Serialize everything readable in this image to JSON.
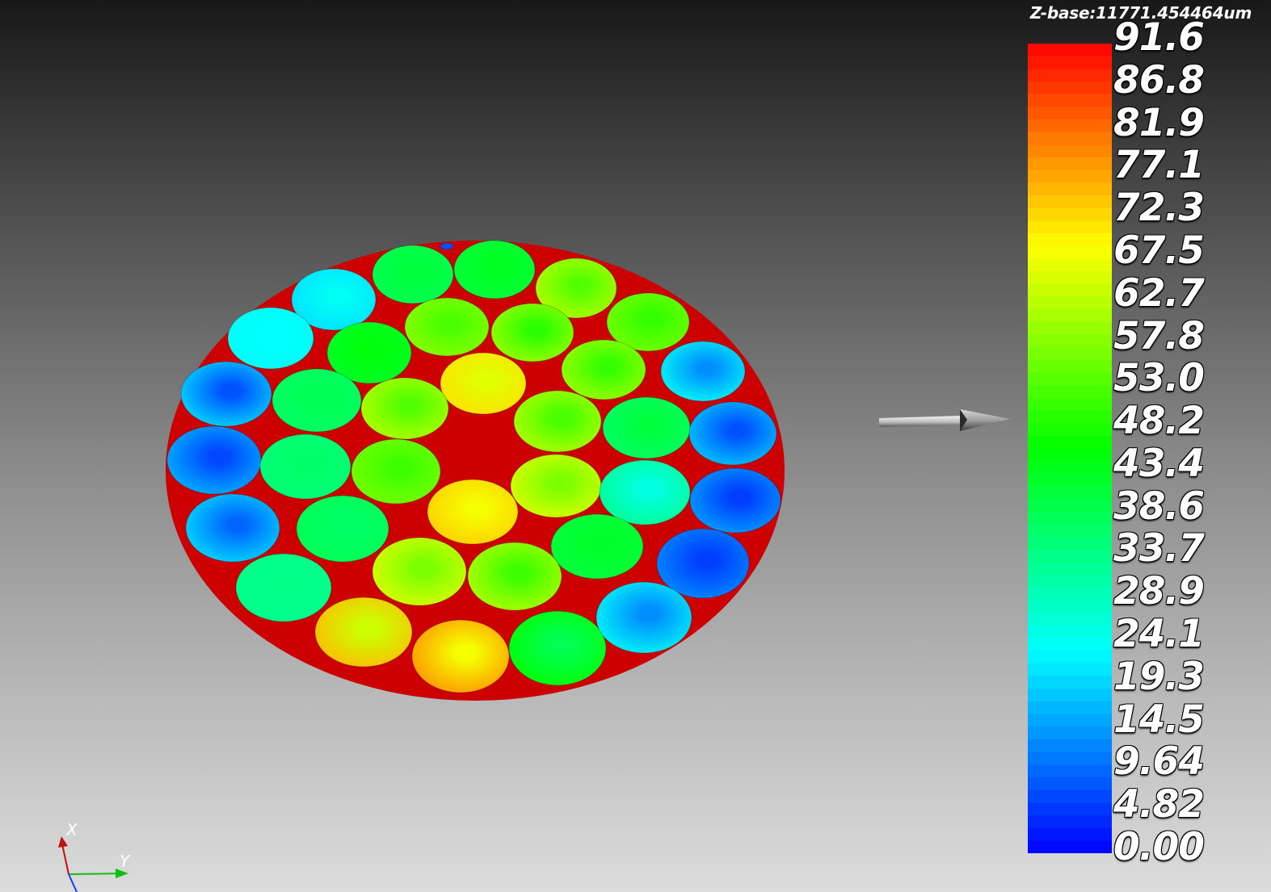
{
  "viewport": {
    "z_base_label": "Z-base:11771.454464um"
  },
  "color_scale": {
    "labels": [
      "91.6",
      "86.8",
      "81.9",
      "77.1",
      "72.3",
      "67.5",
      "62.7",
      "57.8",
      "53.0",
      "48.2",
      "43.4",
      "38.6",
      "33.7",
      "28.9",
      "24.1",
      "19.3",
      "14.5",
      "9.64",
      "4.82",
      "0.00"
    ],
    "max": 91.6,
    "min": 0.0,
    "colormap": [
      "#0000ff",
      "#00ffff",
      "#00ff00",
      "#ffff00",
      "#ff0000"
    ]
  },
  "axes": {
    "x_label": "X",
    "y_label": "Y",
    "x_color": "#c01010",
    "y_color": "#10c010",
    "z_color": "#1040ff"
  },
  "part": {
    "plate_color": "#cc0000",
    "pocket_count": 37
  },
  "icons": {
    "light_direction": "light-direction-arrow-icon",
    "axes_triad": "axes-triad-icon"
  }
}
